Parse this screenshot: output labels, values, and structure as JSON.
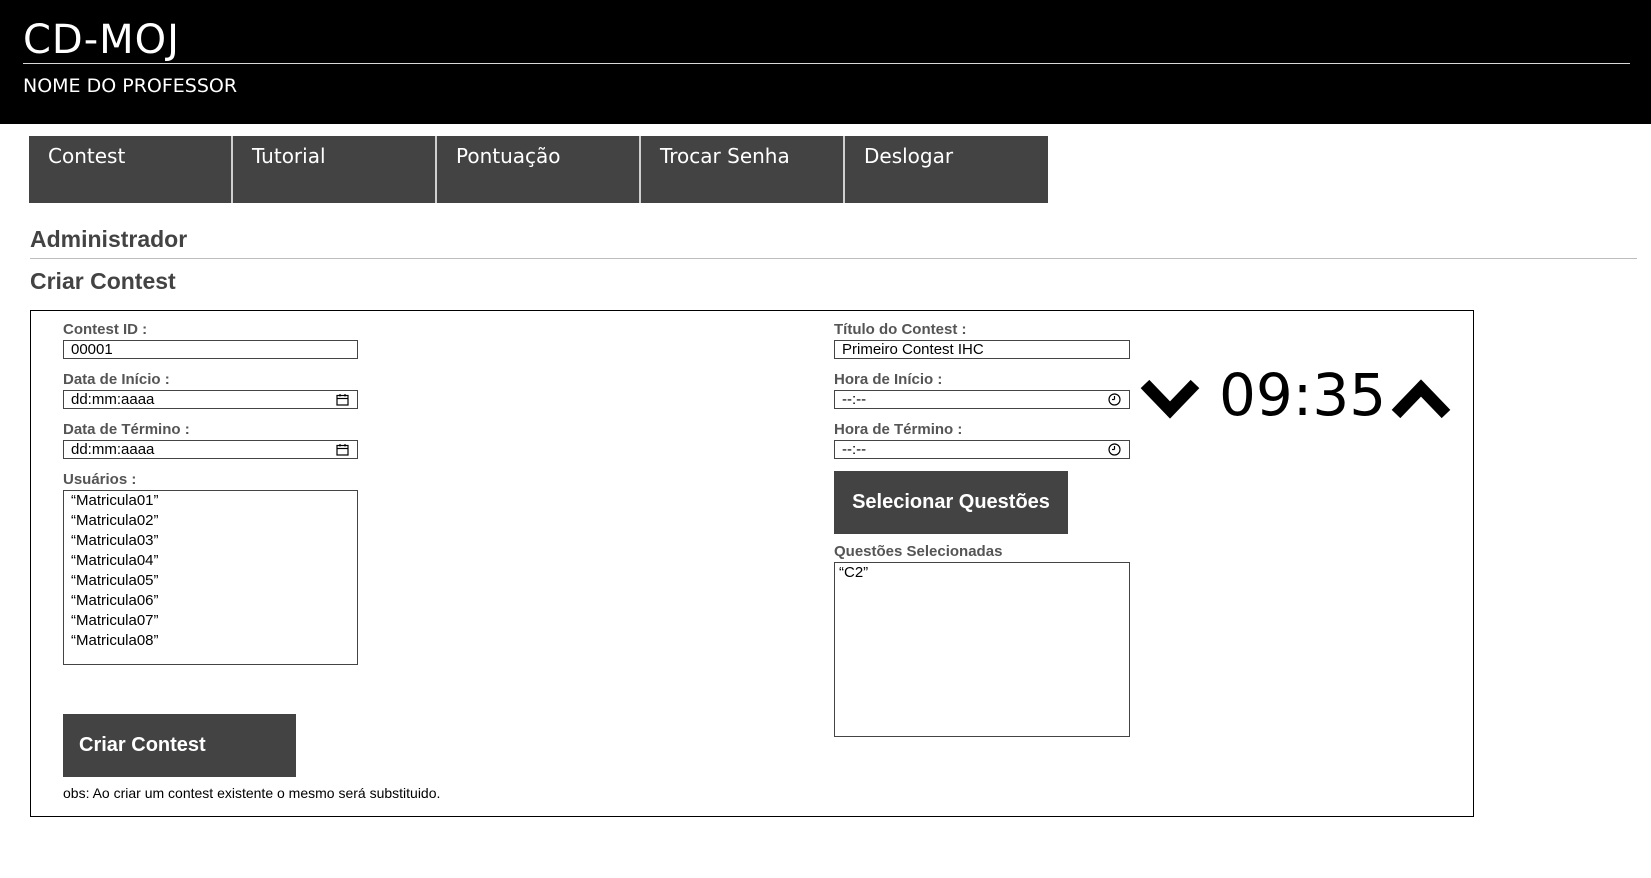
{
  "header": {
    "app_title": "CD-MOJ",
    "professor_name": "NOME DO PROFESSOR"
  },
  "nav": {
    "items": [
      {
        "label": "Contest"
      },
      {
        "label": "Tutorial"
      },
      {
        "label": "Pontuação"
      },
      {
        "label": "Trocar Senha"
      },
      {
        "label": "Deslogar"
      }
    ]
  },
  "page": {
    "section_title": "Administrador",
    "subsection_title": "Criar Contest"
  },
  "form": {
    "contest_id": {
      "label": "Contest ID :",
      "value": "00001"
    },
    "data_inicio": {
      "label": "Data de Início :",
      "value": "dd:mm:aaaa",
      "icon": "calendar-icon"
    },
    "data_termino": {
      "label": "Data de Término :",
      "value": "dd:mm:aaaa",
      "icon": "calendar-icon"
    },
    "usuarios": {
      "label": "Usuários :",
      "items": [
        "“Matricula01”",
        "“Matricula02”",
        "“Matricula03”",
        "“Matricula04”",
        "“Matricula05”",
        "“Matricula06”",
        "“Matricula07”",
        "“Matricula08”"
      ]
    },
    "titulo": {
      "label": "Título do Contest :",
      "value": "Primeiro Contest IHC"
    },
    "hora_inicio": {
      "label": "Hora de Início :",
      "value": "--:--",
      "icon": "clock-icon"
    },
    "hora_termino": {
      "label": "Hora de Término :",
      "value": "--:--",
      "icon": "clock-icon"
    },
    "selecionar_label": "Selecionar Questões",
    "questoes": {
      "label": "Questões Selecionadas",
      "items": [
        "“C2”"
      ]
    },
    "criar_label": "Criar Contest",
    "obs": "obs: Ao criar um contest existente o mesmo será substituido."
  },
  "time_picker": {
    "value": "09:35",
    "down_icon": "chevron-down-icon",
    "up_icon": "chevron-up-icon"
  },
  "colors": {
    "header_bg": "#000000",
    "nav_bg": "#434343",
    "button_bg": "#434343",
    "heading_text": "#434343"
  }
}
